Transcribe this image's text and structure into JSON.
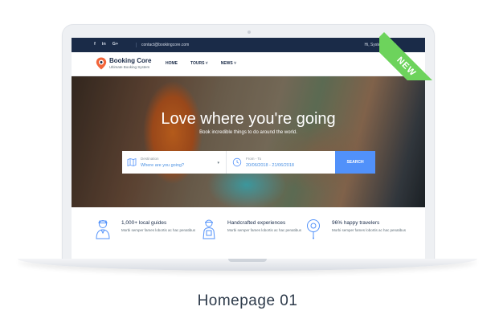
{
  "topbar": {
    "social": [
      "f",
      "in",
      "G+"
    ],
    "email": "contact@bookingcore.com",
    "user": "Hi, System Admin"
  },
  "header": {
    "logo_title": "Booking Core",
    "logo_subtitle": "Ultimate Booking System",
    "nav": [
      "HOME",
      "TOURS ˅",
      "NEWS ˅"
    ]
  },
  "hero": {
    "title": "Love where you're going",
    "subtitle": "Book incredible things to do around the world.",
    "destination_label": "Destination",
    "destination_value": "Where are you going?",
    "date_label": "From - To",
    "date_value": "20/06/2018 - 21/06/2018",
    "search_label": "SEARCH"
  },
  "features": [
    {
      "title": "1,000+ local guides",
      "desc": "Morbi semper fames lobortis ac hac penatibus"
    },
    {
      "title": "Handcrafted experiences",
      "desc": "Morbi semper fames lobortis ac hac penatibus"
    },
    {
      "title": "96% happy travelers",
      "desc": "Morbi semper fames lobortis ac hac penatibus"
    }
  ],
  "ribbon": "NEW",
  "caption": "Homepage 01",
  "colors": {
    "navy": "#1a2b48",
    "accent_blue": "#5191fa",
    "ribbon_green": "#6dd35c",
    "logo_orange": "#f2653a"
  }
}
